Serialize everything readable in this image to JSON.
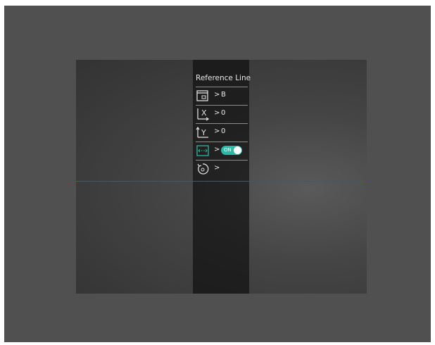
{
  "menu": {
    "title": "Reference Line",
    "items": [
      {
        "icon": "reference-position-icon",
        "chevron": ">",
        "value": "B"
      },
      {
        "icon": "x-axis-icon",
        "chevron": ">",
        "value": "0"
      },
      {
        "icon": "y-axis-icon",
        "chevron": ">",
        "value": "0"
      },
      {
        "icon": "reference-line-toggle-icon",
        "chevron": ">",
        "toggle_label": "ON",
        "toggle_state": "on"
      },
      {
        "icon": "reset-icon",
        "chevron": ">"
      }
    ]
  },
  "colors": {
    "accent": "#2bb9a4",
    "reference_line": "#d11f1f"
  }
}
